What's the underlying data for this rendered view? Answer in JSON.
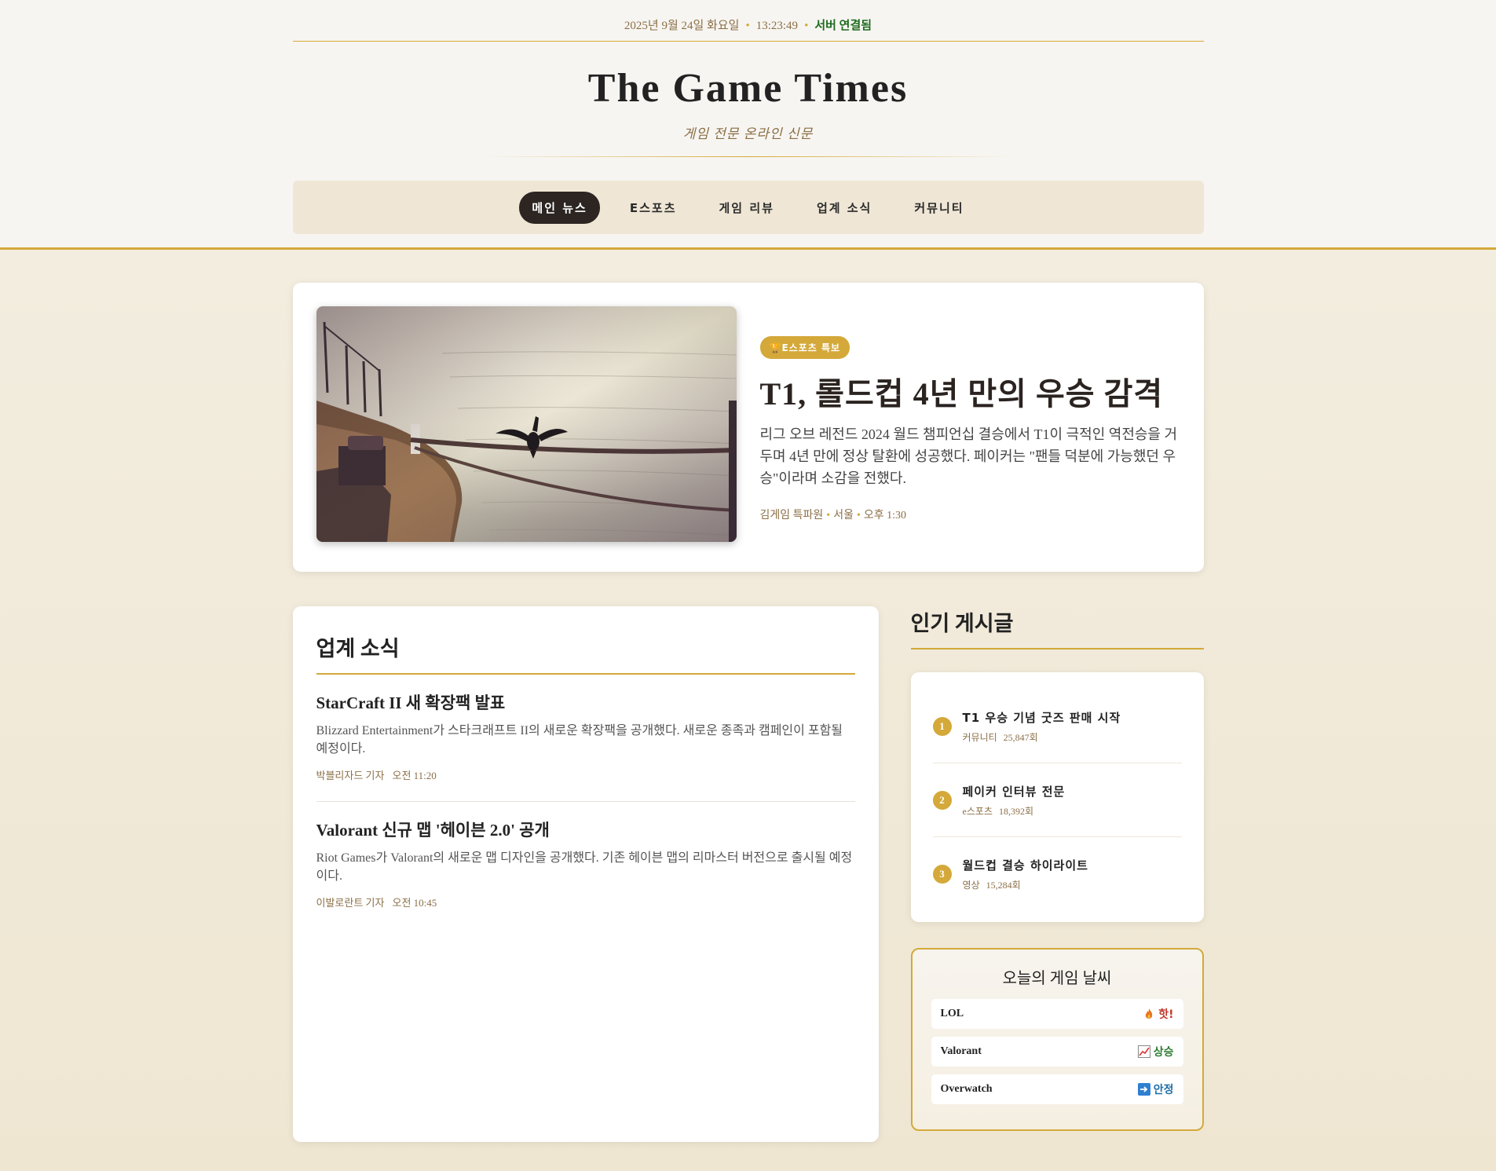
{
  "topbar": {
    "date": "2025년 9월 24일 화요일",
    "time": "13:23:49",
    "status": "서버 연결됨"
  },
  "masthead": {
    "title": "The Game Times",
    "subtitle": "게임 전문 온라인 신문"
  },
  "nav": {
    "items": [
      {
        "label": "메인 뉴스",
        "active": true
      },
      {
        "label": "E스포츠",
        "active": false
      },
      {
        "label": "게임 리뷰",
        "active": false
      },
      {
        "label": "업계 소식",
        "active": false
      },
      {
        "label": "커뮤니티",
        "active": false
      }
    ]
  },
  "feature": {
    "badge": "E스포츠 특보",
    "headline": "T1, 롤드컵 4년 만의 우승 감격",
    "summary": "리그 오브 레전드 2024 월드 챔피언십 결승에서 T1이 극적인 역전승을 거두며 4년 만에 정상 탈환에 성공했다. 페이커는 \"팬들 덕분에 가능했던 우승\"이라며 소감을 전했다.",
    "author": "김게임 특파원",
    "location": "서울",
    "time": "오후 1:30"
  },
  "industry": {
    "title": "업계 소식",
    "articles": [
      {
        "title": "StarCraft II 새 확장팩 발표",
        "body": "Blizzard Entertainment가 스타크래프트 II의 새로운 확장팩을 공개했다. 새로운 종족과 캠페인이 포함될 예정이다.",
        "author": "박블리자드 기자",
        "time": "오전 11:20"
      },
      {
        "title": "Valorant 신규 맵 '헤이븐 2.0' 공개",
        "body": "Riot Games가 Valorant의 새로운 맵 디자인을 공개했다. 기존 헤이븐 맵의 리마스터 버전으로 출시될 예정이다.",
        "author": "이발로란트 기자",
        "time": "오전 10:45"
      }
    ]
  },
  "popular": {
    "title": "인기 게시글",
    "items": [
      {
        "rank": "1",
        "title": "T1 우승 기념 굿즈 판매 시작",
        "category": "커뮤니티",
        "views": "25,847회"
      },
      {
        "rank": "2",
        "title": "페이커 인터뷰 전문",
        "category": "e스포츠",
        "views": "18,392회"
      },
      {
        "rank": "3",
        "title": "월드컵 결승 하이라이트",
        "category": "영상",
        "views": "15,284회"
      }
    ]
  },
  "weather": {
    "title": "오늘의 게임 날씨",
    "rows": [
      {
        "game": "LOL",
        "icon": "fire-icon",
        "status": "핫!",
        "color": "#c0392b"
      },
      {
        "game": "Valorant",
        "icon": "chart-up-icon",
        "status": "상승",
        "color": "#2e7d32"
      },
      {
        "game": "Overwatch",
        "icon": "arrow-right-icon",
        "status": "안정",
        "color": "#1f6fa8"
      }
    ]
  },
  "colors": {
    "accent": "#d4a93a",
    "nav_active_bg": "#2c2522",
    "meta_text": "#8b6f47"
  }
}
